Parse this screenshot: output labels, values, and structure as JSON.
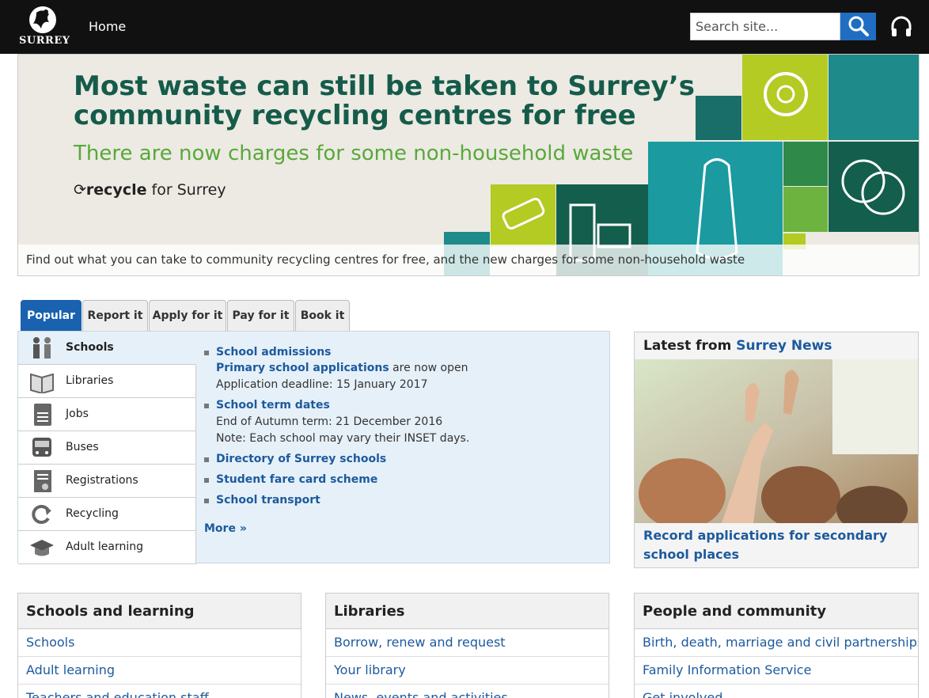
{
  "header": {
    "logo_text": "SURREY",
    "nav_home": "Home",
    "search_placeholder": "Search site...",
    "search_icon": "search-icon",
    "audio_icon": "headphones-icon"
  },
  "banner": {
    "headline": "Most waste can still be taken to Surrey’s community recycling centres for free",
    "subheadline": "There are now charges for some non-household waste",
    "logo_bold": "recycle",
    "logo_rest": " for Surrey",
    "caption": "Find out what you can take to community recycling centres for free, and the new charges for some non-household waste"
  },
  "tabs": [
    {
      "label": "Popular"
    },
    {
      "label": "Report it"
    },
    {
      "label": "Apply for it"
    },
    {
      "label": "Pay for it"
    },
    {
      "label": "Book it"
    }
  ],
  "categories": [
    {
      "label": "Schools",
      "icon": "people-icon"
    },
    {
      "label": "Libraries",
      "icon": "book-icon"
    },
    {
      "label": "Jobs",
      "icon": "cv-icon"
    },
    {
      "label": "Buses",
      "icon": "bus-icon"
    },
    {
      "label": "Registrations",
      "icon": "certificate-icon"
    },
    {
      "label": "Recycling",
      "icon": "recycle-icon"
    },
    {
      "label": "Adult learning",
      "icon": "mortarboard-icon"
    }
  ],
  "links": {
    "school_admissions": "School admissions",
    "primary_link": "Primary school applications",
    "primary_suffix": " are now open",
    "app_deadline": "Application deadline: 15 January 2017",
    "term_dates": "School term dates",
    "end_autumn": "End of Autumn term: 21 December 2016",
    "inset_note": "Note: Each school may vary their INSET days.",
    "directory": "Directory of Surrey schools",
    "fare_card": "Student fare card scheme",
    "transport": "School transport",
    "more": "More »"
  },
  "news": {
    "title_prefix": "Latest from ",
    "title_link": "Surrey News",
    "caption": "Record applications for secondary school places"
  },
  "boxes": [
    {
      "title": "Schools and learning",
      "items": [
        "Schools",
        "Adult learning",
        "Teachers and education staff"
      ]
    },
    {
      "title": "Libraries",
      "items": [
        "Borrow, renew and request",
        "Your library",
        "News, events and activities"
      ]
    },
    {
      "title": "People and community",
      "items": [
        "Birth, death, marriage and civil partnerships",
        "Family Information Service",
        "Get involved"
      ]
    }
  ],
  "colors": {
    "accent_blue": "#1a62b0",
    "link": "#1c5a9e",
    "banner_green": "#155b4a"
  }
}
